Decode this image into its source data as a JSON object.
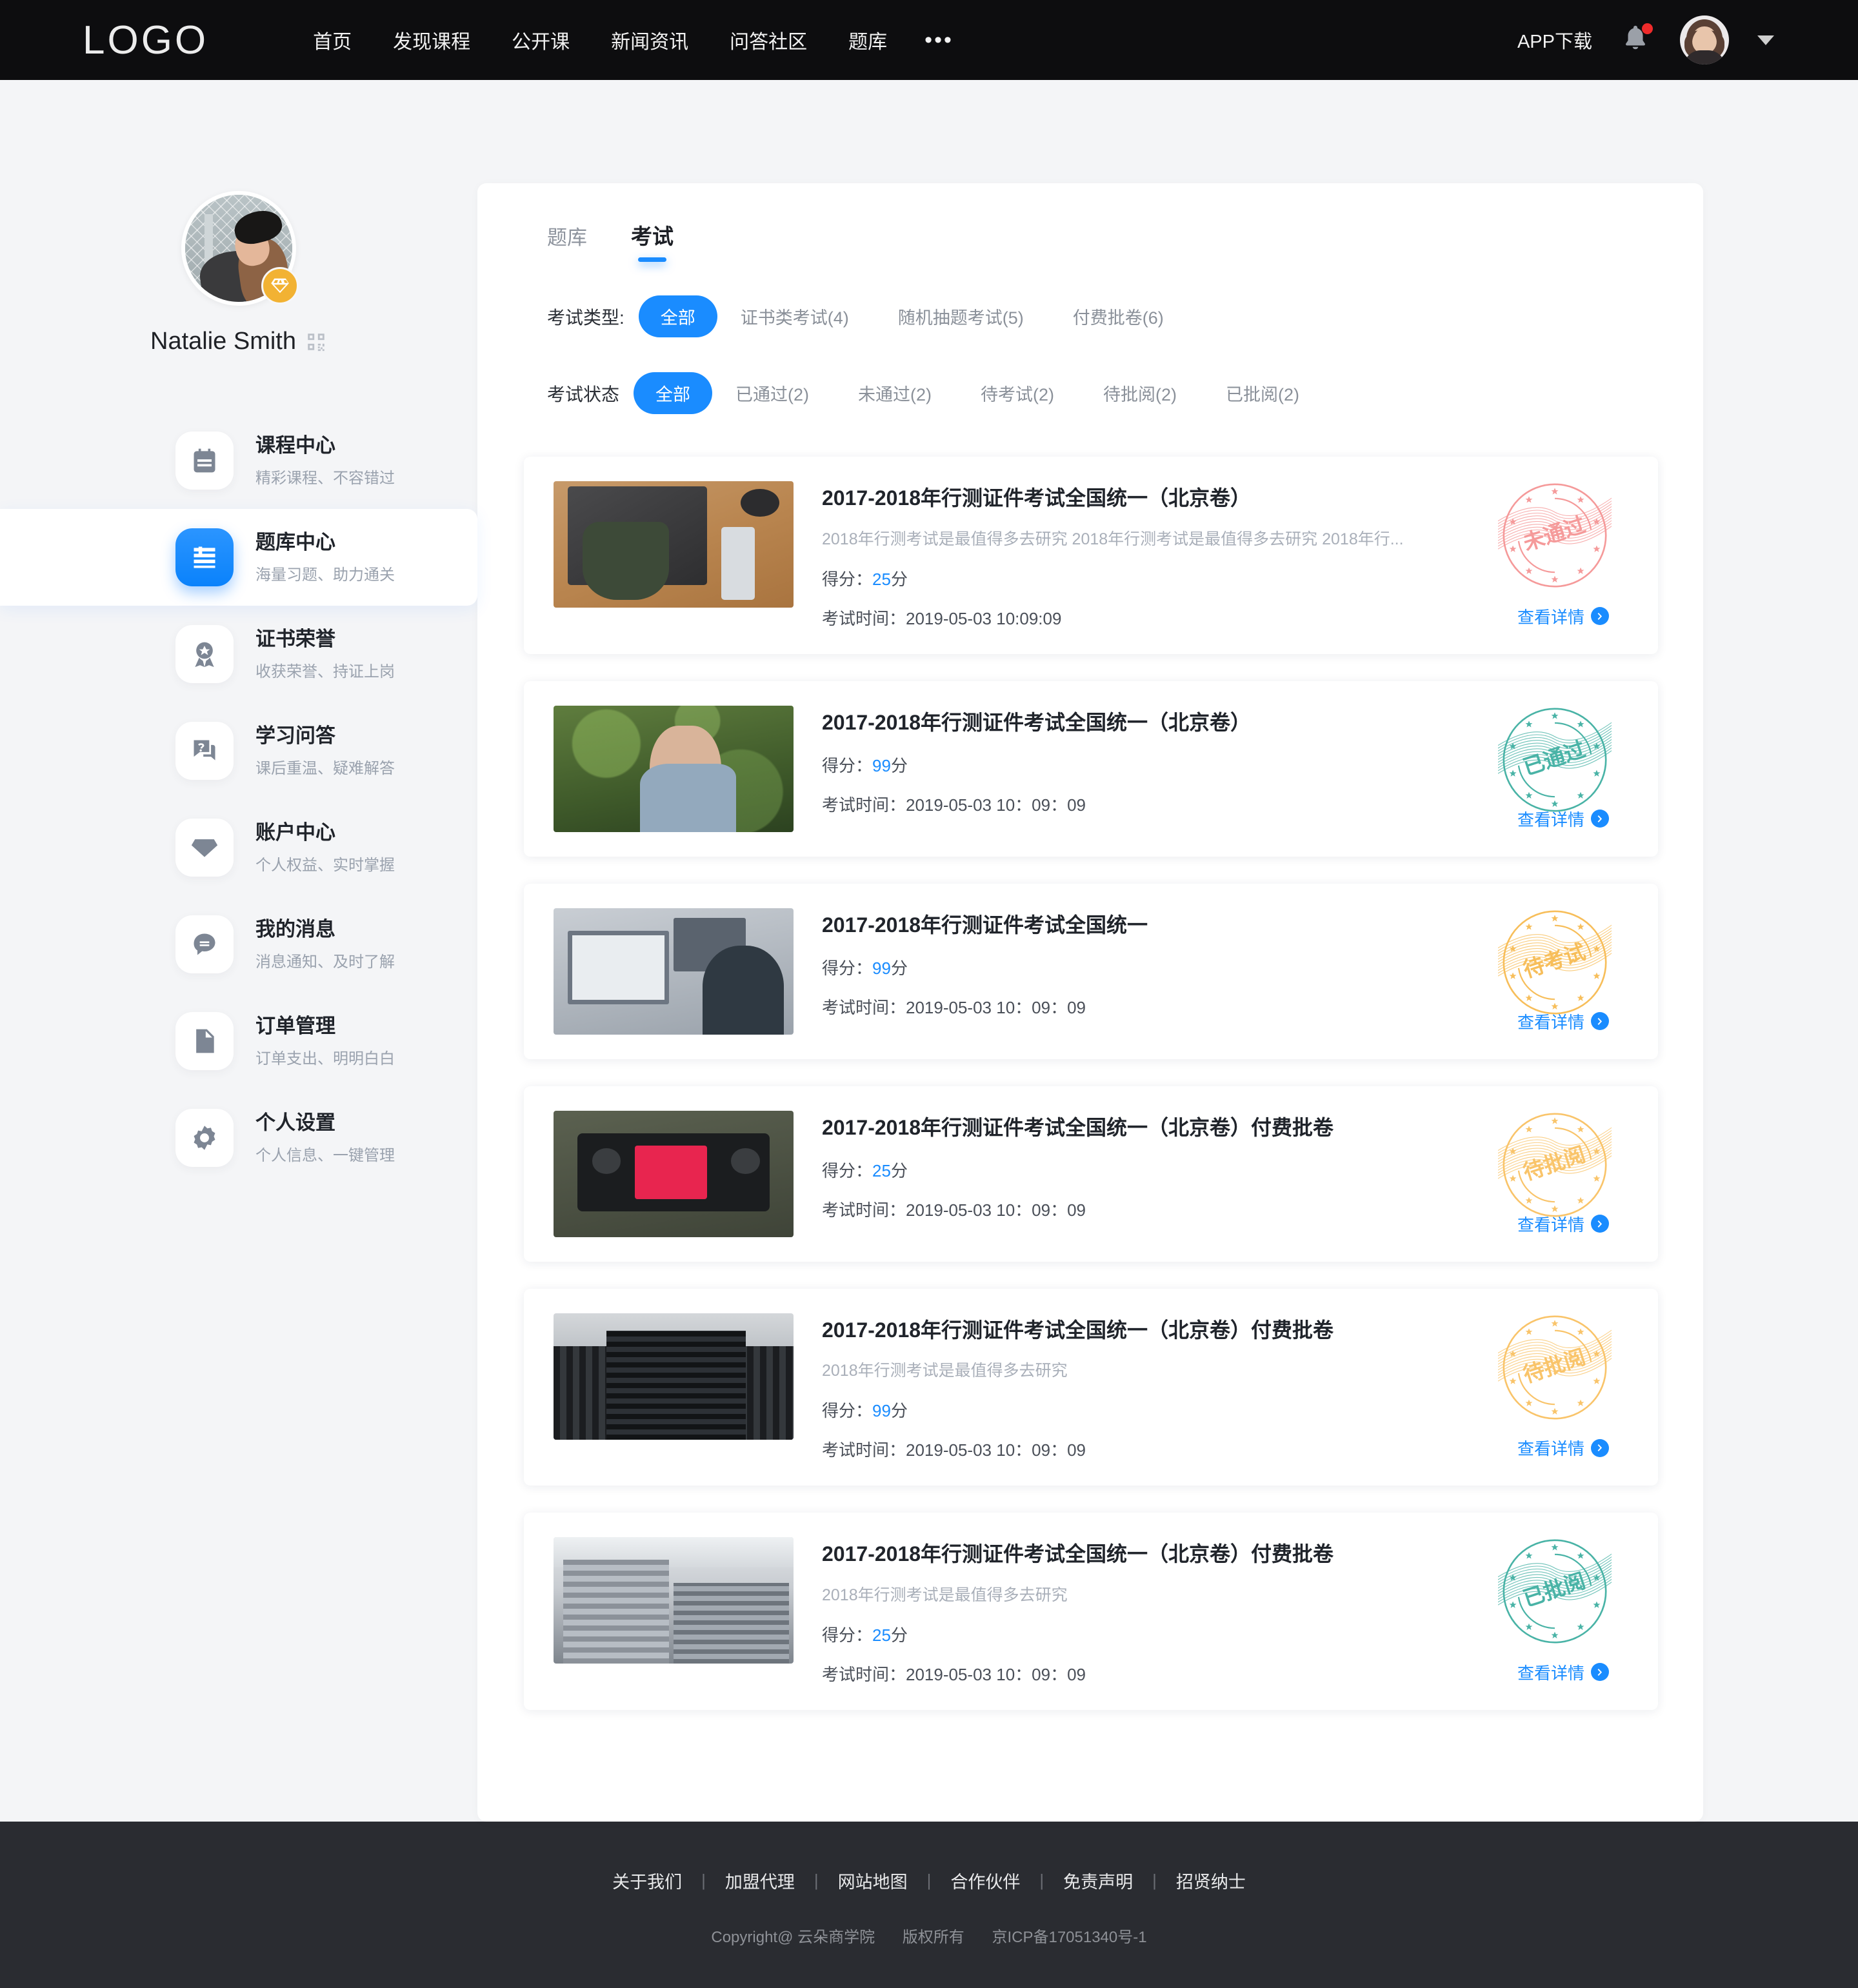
{
  "topnav": {
    "logo": "LOGO",
    "links": [
      "首页",
      "发现课程",
      "公开课",
      "新闻资讯",
      "问答社区",
      "题库"
    ],
    "more": "•••",
    "app_download": "APP下载",
    "bell_icon": "bell-icon",
    "avatar_icon": "user-avatar",
    "chevron": "chevron-down-icon"
  },
  "sidebar": {
    "user_name": "Natalie Smith",
    "vip_badge_icon": "diamond-icon",
    "qr_icon": "qrcode-icon",
    "items": [
      {
        "title": "课程中心",
        "sub": "精彩课程、不容错过",
        "icon": "calendar-icon",
        "active": false
      },
      {
        "title": "题库中心",
        "sub": "海量习题、助力通关",
        "icon": "book-icon",
        "active": true
      },
      {
        "title": "证书荣誉",
        "sub": "收获荣誉、持证上岗",
        "icon": "medal-icon",
        "active": false
      },
      {
        "title": "学习问答",
        "sub": "课后重温、疑难解答",
        "icon": "chat-question-icon",
        "active": false
      },
      {
        "title": "账户中心",
        "sub": "个人权益、实时掌握",
        "icon": "diamond-icon",
        "active": false
      },
      {
        "title": "我的消息",
        "sub": "消息通知、及时了解",
        "icon": "message-icon",
        "active": false
      },
      {
        "title": "订单管理",
        "sub": "订单支出、明明白白",
        "icon": "document-icon",
        "active": false
      },
      {
        "title": "个人设置",
        "sub": "个人信息、一键管理",
        "icon": "gear-icon",
        "active": false
      }
    ]
  },
  "main": {
    "tabs": [
      {
        "label": "题库",
        "active": false
      },
      {
        "label": "考试",
        "active": true
      }
    ],
    "filters": [
      {
        "label": "考试类型:",
        "chips": [
          {
            "label": "全部",
            "active": true
          },
          {
            "label": "证书类考试(4)",
            "active": false
          },
          {
            "label": "随机抽题考试(5)",
            "active": false
          },
          {
            "label": "付费批卷(6)",
            "active": false
          }
        ]
      },
      {
        "label": "考试状态",
        "chips": [
          {
            "label": "全部",
            "active": true
          },
          {
            "label": "已通过(2)",
            "active": false
          },
          {
            "label": "未通过(2)",
            "active": false
          },
          {
            "label": "待考试(2)",
            "active": false
          },
          {
            "label": "待批阅(2)",
            "active": false
          },
          {
            "label": "已批阅(2)",
            "active": false
          }
        ]
      }
    ],
    "detail_link_label": "查看详情",
    "score_label": "得分：",
    "score_unit": "分",
    "time_label": "考试时间：",
    "cards": [
      {
        "title": "2017-2018年行测证件考试全国统一（北京卷）",
        "desc": "2018年行测考试是最值得多去研究 2018年行测考试是最值得多去研究 2018年行...",
        "score": "25",
        "time": "2019-05-03  10:09:09",
        "stamp_text": "未通过",
        "stamp_color": "#f59a9a",
        "thumb": "t1"
      },
      {
        "title": "2017-2018年行测证件考试全国统一（北京卷）",
        "desc": "",
        "score": "99",
        "time": "2019-05-03  10：09：09",
        "stamp_text": "已通过",
        "stamp_color": "#49b3a6",
        "thumb": "t2"
      },
      {
        "title": "2017-2018年行测证件考试全国统一",
        "desc": "",
        "score": "99",
        "time": "2019-05-03  10：09：09",
        "stamp_text": "待考试",
        "stamp_color": "#f7be5a",
        "thumb": "t3"
      },
      {
        "title": "2017-2018年行测证件考试全国统一（北京卷）付费批卷",
        "desc": "",
        "score": "25",
        "time": "2019-05-03  10：09：09",
        "stamp_text": "待批阅",
        "stamp_color": "#f9c46a",
        "thumb": "t4"
      },
      {
        "title": "2017-2018年行测证件考试全国统一（北京卷）付费批卷",
        "desc": "2018年行测考试是最值得多去研究",
        "score": "99",
        "time": "2019-05-03  10：09：09",
        "stamp_text": "待批阅",
        "stamp_color": "#f9c46a",
        "thumb": "t5"
      },
      {
        "title": "2017-2018年行测证件考试全国统一（北京卷）付费批卷",
        "desc": "2018年行测考试是最值得多去研究",
        "score": "25",
        "time": "2019-05-03  10：09：09",
        "stamp_text": "已批阅",
        "stamp_color": "#49b3a6",
        "thumb": "t6"
      }
    ]
  },
  "footer": {
    "links": [
      "关于我们",
      "加盟代理",
      "网站地图",
      "合作伙伴",
      "免责声明",
      "招贤纳士"
    ],
    "copyright": "Copyright@ 云朵商学院",
    "rights": "版权所有",
    "icp": "京ICP备17051340号-1"
  },
  "colors": {
    "accent": "#1a8cff",
    "nav_bg": "#0d0d0f",
    "footer_bg": "#2a2c31",
    "page_bg": "#f4f5f7"
  }
}
